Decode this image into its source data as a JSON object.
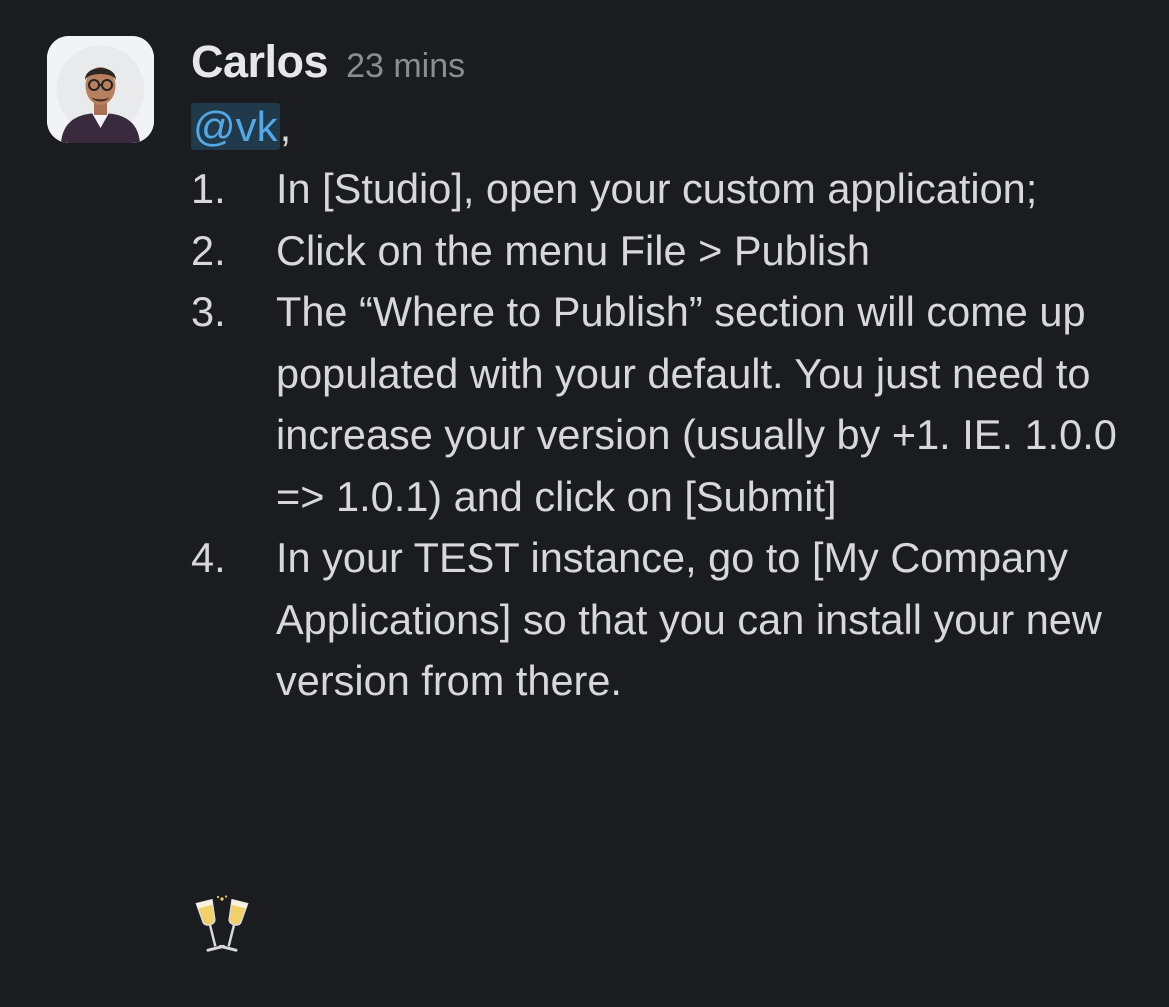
{
  "message": {
    "sender": "Carlos",
    "timestamp": "23 mins",
    "mention": "@vk",
    "mention_suffix": ",",
    "steps": [
      {
        "num": "1.",
        "text": "In [Studio], open your custom application;"
      },
      {
        "num": "2.",
        "text": "Click on the menu File > Publish"
      },
      {
        "num": "3.",
        "text": "The “Where to Publish” section will come up populated with your default. You just need to increase your version (usually by +1. IE. 1.0.0 => 1.0.1) and click on [Submit]"
      },
      {
        "num": "4.",
        "text": "In your TEST instance, go to [My Company Applications] so that you can install your new version from there."
      }
    ],
    "reaction_icon": "champagne-glasses-emoji"
  },
  "colors": {
    "background": "#1b1c20",
    "mention_bg": "#203a4c",
    "mention_text": "#55a8e4"
  }
}
